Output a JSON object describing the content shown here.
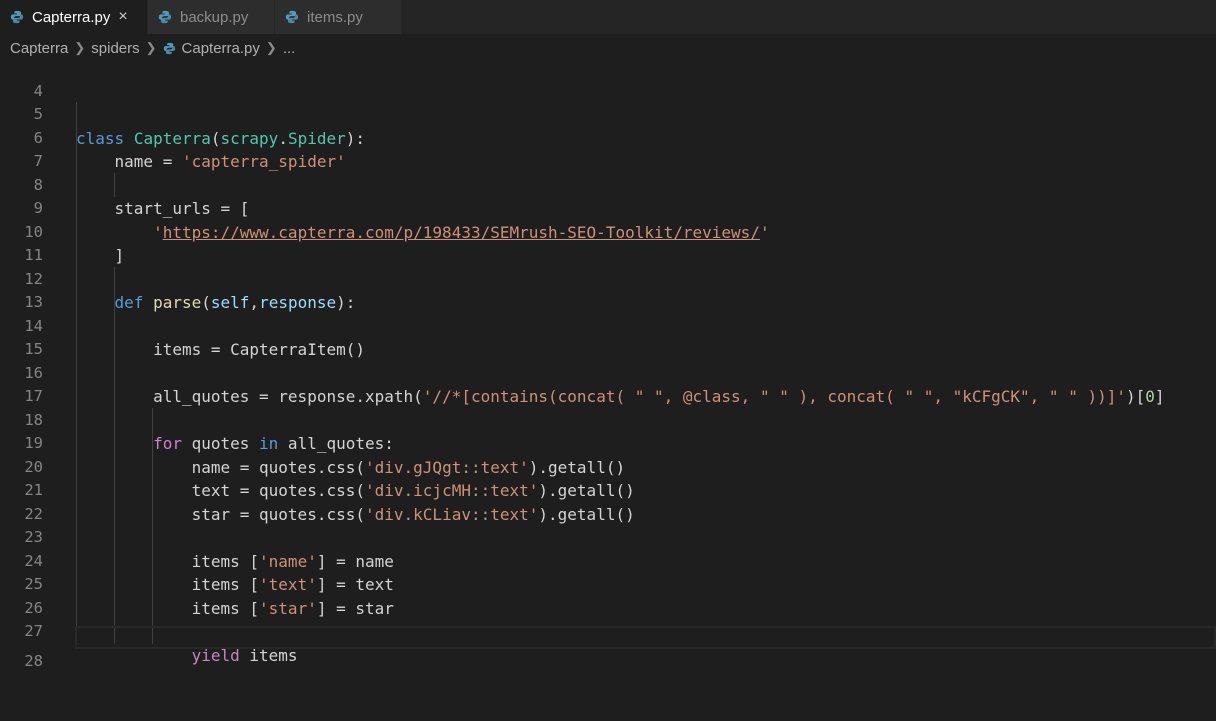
{
  "tabs": [
    {
      "label": "Capterra.py",
      "active": true,
      "close": "×"
    },
    {
      "label": "backup.py",
      "active": false
    },
    {
      "label": "items.py",
      "active": false
    }
  ],
  "breadcrumb": {
    "parts": [
      "Capterra",
      "spiders",
      "Capterra.py",
      "..."
    ]
  },
  "colors": {
    "keyword": "#569cd6",
    "control": "#c586c0",
    "class": "#4ec9b0",
    "function": "#dcdcaa",
    "string": "#ce9178",
    "number": "#b5cea8",
    "background": "#1e1e1e"
  },
  "editor": {
    "lines": [
      {
        "n": "4",
        "t": ""
      },
      {
        "n": "5",
        "t": ""
      },
      {
        "n": "6",
        "t": ""
      },
      {
        "n": "7",
        "t": ""
      },
      {
        "n": "8",
        "t": ""
      },
      {
        "n": "9",
        "t": ""
      },
      {
        "n": "10",
        "t": ""
      },
      {
        "n": "11",
        "t": ""
      },
      {
        "n": "12",
        "t": ""
      },
      {
        "n": "13",
        "t": ""
      },
      {
        "n": "14",
        "t": ""
      },
      {
        "n": "15",
        "t": ""
      },
      {
        "n": "16",
        "t": ""
      },
      {
        "n": "17",
        "t": ""
      },
      {
        "n": "18",
        "t": ""
      },
      {
        "n": "19",
        "t": ""
      },
      {
        "n": "20",
        "t": ""
      },
      {
        "n": "21",
        "t": ""
      },
      {
        "n": "22",
        "t": ""
      },
      {
        "n": "23",
        "t": ""
      },
      {
        "n": "24",
        "t": ""
      },
      {
        "n": "25",
        "t": ""
      },
      {
        "n": "26",
        "t": ""
      },
      {
        "n": "27",
        "t": ""
      },
      {
        "n": "28",
        "t": ""
      }
    ],
    "tokens": {
      "l5": [
        "class",
        " ",
        "Capterra",
        "(",
        "scrapy",
        ".",
        "Spider",
        "):"
      ],
      "l6": [
        "    name = ",
        "'capterra_spider'"
      ],
      "l8": [
        "    start_urls = ["
      ],
      "l9": [
        "        '",
        "https://www.capterra.com/p/198433/SEMrush-SEO-Toolkit/reviews/",
        "'"
      ],
      "l10": [
        "    ]"
      ],
      "l12": [
        "    ",
        "def",
        " ",
        "parse",
        "(",
        "self",
        ",",
        "response",
        "):"
      ],
      "l14": [
        "        items = ",
        "CapterraItem",
        "()"
      ],
      "l16": [
        "        all_quotes = response.",
        "xpath",
        "(",
        "'//*[contains(concat( \" \", @class, \" \" ), concat( \" \", \"kCFgCK\", \" \" ))]'",
        ")[",
        "0",
        "]"
      ],
      "l18": [
        "        ",
        "for",
        " quotes ",
        "in",
        " all_quotes:"
      ],
      "l19": [
        "            name = quotes.",
        "css",
        "(",
        "'div.gJQgt::text'",
        ").",
        "getall",
        "()"
      ],
      "l20": [
        "            text = quotes.",
        "css",
        "(",
        "'div.icjcMH::text'",
        ").",
        "getall",
        "()"
      ],
      "l21": [
        "            star = quotes.",
        "css",
        "(",
        "'div.kCLiav::text'",
        ").",
        "getall",
        "()"
      ],
      "l23": [
        "            items [",
        "'name'",
        "] = name"
      ],
      "l24": [
        "            items [",
        "'text'",
        "] = text"
      ],
      "l25": [
        "            items [",
        "'star'",
        "] = star"
      ],
      "l27": [
        "            ",
        "yield",
        " items"
      ]
    }
  }
}
